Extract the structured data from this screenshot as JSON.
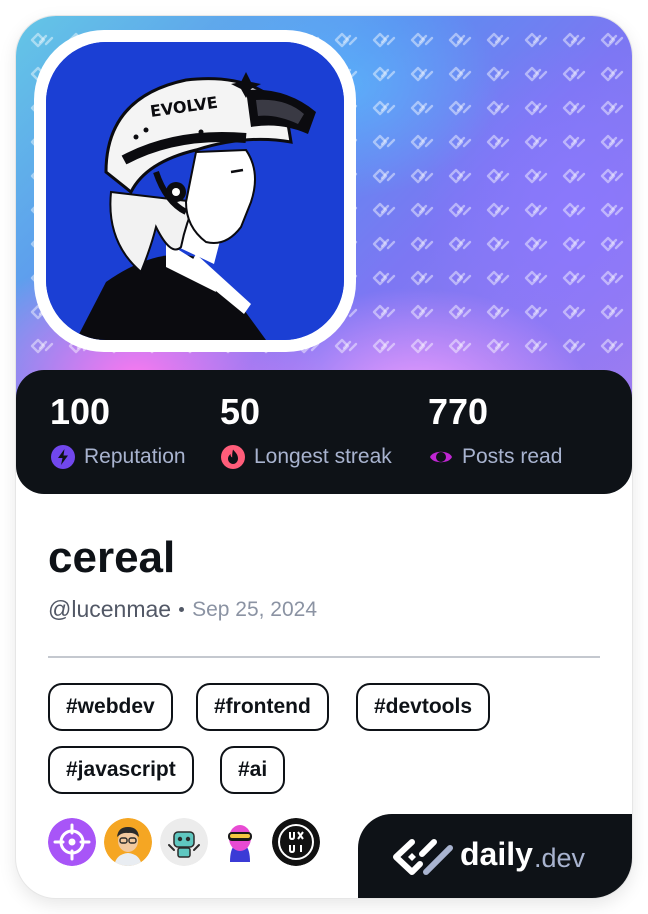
{
  "profile": {
    "name": "cereal",
    "handle": "@lucenmae",
    "joined": "Sep 25, 2024"
  },
  "stats": [
    {
      "value": "100",
      "label": "Reputation",
      "icon": "lightning-bolt-icon",
      "color": "#7147ed"
    },
    {
      "value": "50",
      "label": "Longest streak",
      "icon": "flame-icon",
      "color": "#ff5d7a"
    },
    {
      "value": "770",
      "label": "Posts read",
      "icon": "eye-ring-icon",
      "color": "#c026d3"
    }
  ],
  "tags": [
    "#webdev",
    "#frontend",
    "#devtools",
    "#javascript",
    "#ai"
  ],
  "badges": [
    {
      "name": "crosshair-badge",
      "color": "#a855f7"
    },
    {
      "name": "memoji-avatar-badge",
      "color": "#f5a623"
    },
    {
      "name": "robot-badge",
      "color": "#e8e8e8"
    },
    {
      "name": "vr-head-badge",
      "color": "#ffffff"
    },
    {
      "name": "uxui-badge",
      "color": "#111111"
    }
  ],
  "brand": {
    "name": "daily",
    "suffix": ".dev"
  },
  "avatar_text": "EVOLVE"
}
